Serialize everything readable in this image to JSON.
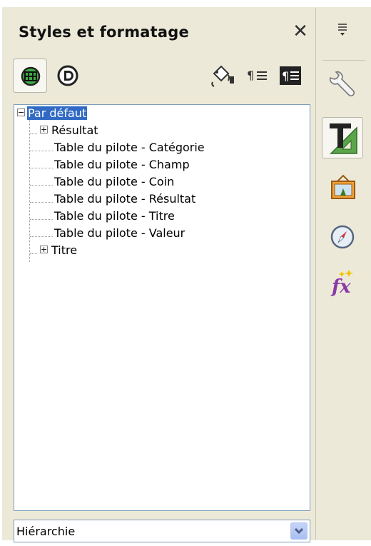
{
  "panel": {
    "title": "Styles et formatage",
    "close_glyph": "✕"
  },
  "toolbar": {
    "buttons": [
      {
        "name": "cell-styles-icon",
        "active": true
      },
      {
        "name": "page-styles-icon",
        "active": false
      },
      {
        "name": "fill-format-mode-icon"
      },
      {
        "name": "new-style-from-selection-icon"
      },
      {
        "name": "update-style-icon"
      }
    ]
  },
  "tree": {
    "root": "Par défaut",
    "items": [
      "Résultat",
      "Table du pilote - Catégorie",
      "Table du pilote - Champ",
      "Table du pilote - Coin",
      "Table du pilote - Résultat",
      "Table du pilote - Titre",
      "Table du pilote - Valeur",
      "Titre"
    ],
    "expander_glyph_collapsed": "+",
    "expander_glyph_expanded": "−"
  },
  "filter": {
    "value": "Hiérarchie"
  },
  "sidebar": {
    "buttons": [
      {
        "name": "menu-icon"
      },
      {
        "name": "properties-icon"
      },
      {
        "name": "styles-icon",
        "active": true
      },
      {
        "name": "gallery-icon"
      },
      {
        "name": "navigator-icon"
      },
      {
        "name": "functions-icon"
      }
    ]
  },
  "colors": {
    "selection": "#316ac5",
    "panel_bg": "#ece9d8",
    "border": "#7f9db9"
  }
}
